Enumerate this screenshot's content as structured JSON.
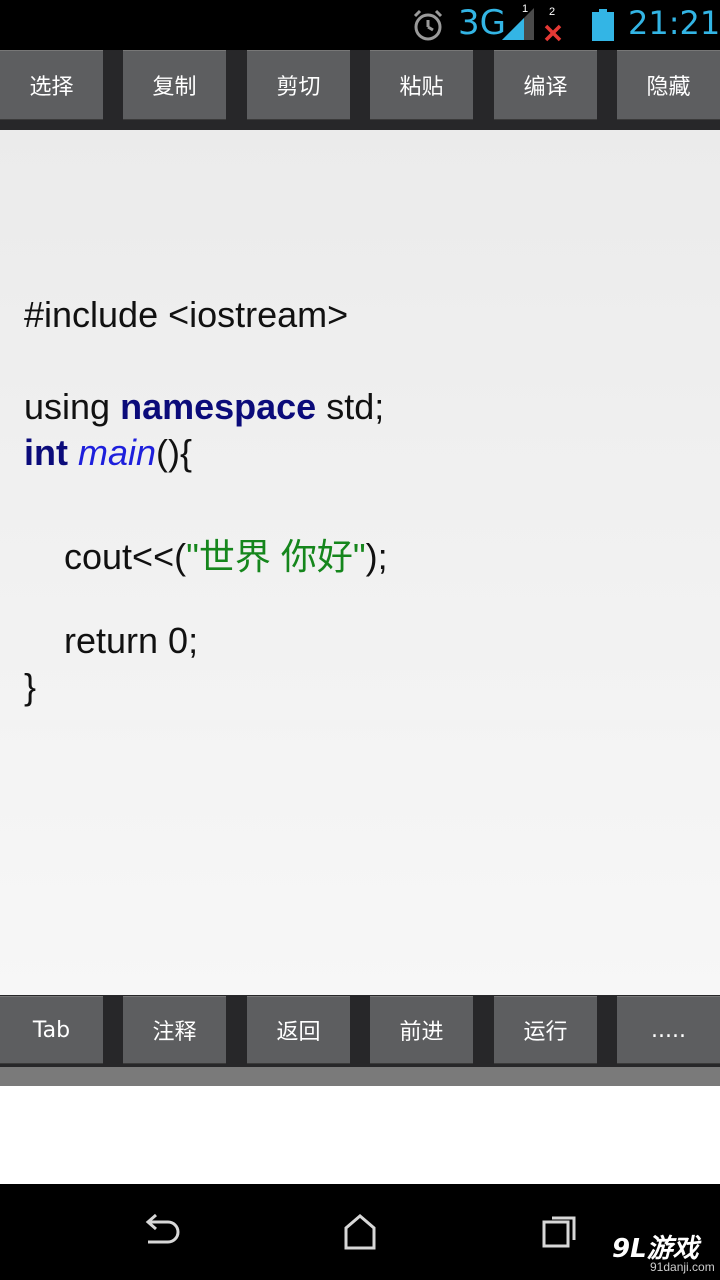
{
  "status_bar": {
    "network_type": "3G",
    "sim1_label": "1",
    "sim2_label": "2",
    "time": "21:21",
    "icons": [
      "alarm-icon",
      "signal-icon",
      "sim2-no-signal-icon",
      "battery-icon"
    ],
    "accent_color": "#33b5e5"
  },
  "top_toolbar": {
    "buttons": [
      "选择",
      "复制",
      "剪切",
      "粘贴",
      "编译",
      "隐藏"
    ]
  },
  "editor": {
    "lines": {
      "l1": "#include <iostream>",
      "l2a": "using ",
      "l2b": "namespace",
      "l2c": " std;",
      "l3a": "int",
      "l3b": " ",
      "l3c": "main",
      "l3d": "(){",
      "l4a": "    cout<<(",
      "l4b": "\"世界 你好\"",
      "l4c": ");",
      "l5": "    return 0;",
      "l6": "}"
    },
    "colors": {
      "keyword": "#0b0b7a",
      "function": "#1d1fdc",
      "string": "#15861c"
    }
  },
  "bottom_toolbar": {
    "buttons": [
      "Tab",
      "注释",
      "返回",
      "前进",
      "运行",
      "....."
    ]
  },
  "nav_bar": {
    "icons": [
      "back-icon",
      "home-icon",
      "recent-apps-icon"
    ]
  },
  "watermark": {
    "text": "9L游戏",
    "sub": "91danji.com"
  }
}
